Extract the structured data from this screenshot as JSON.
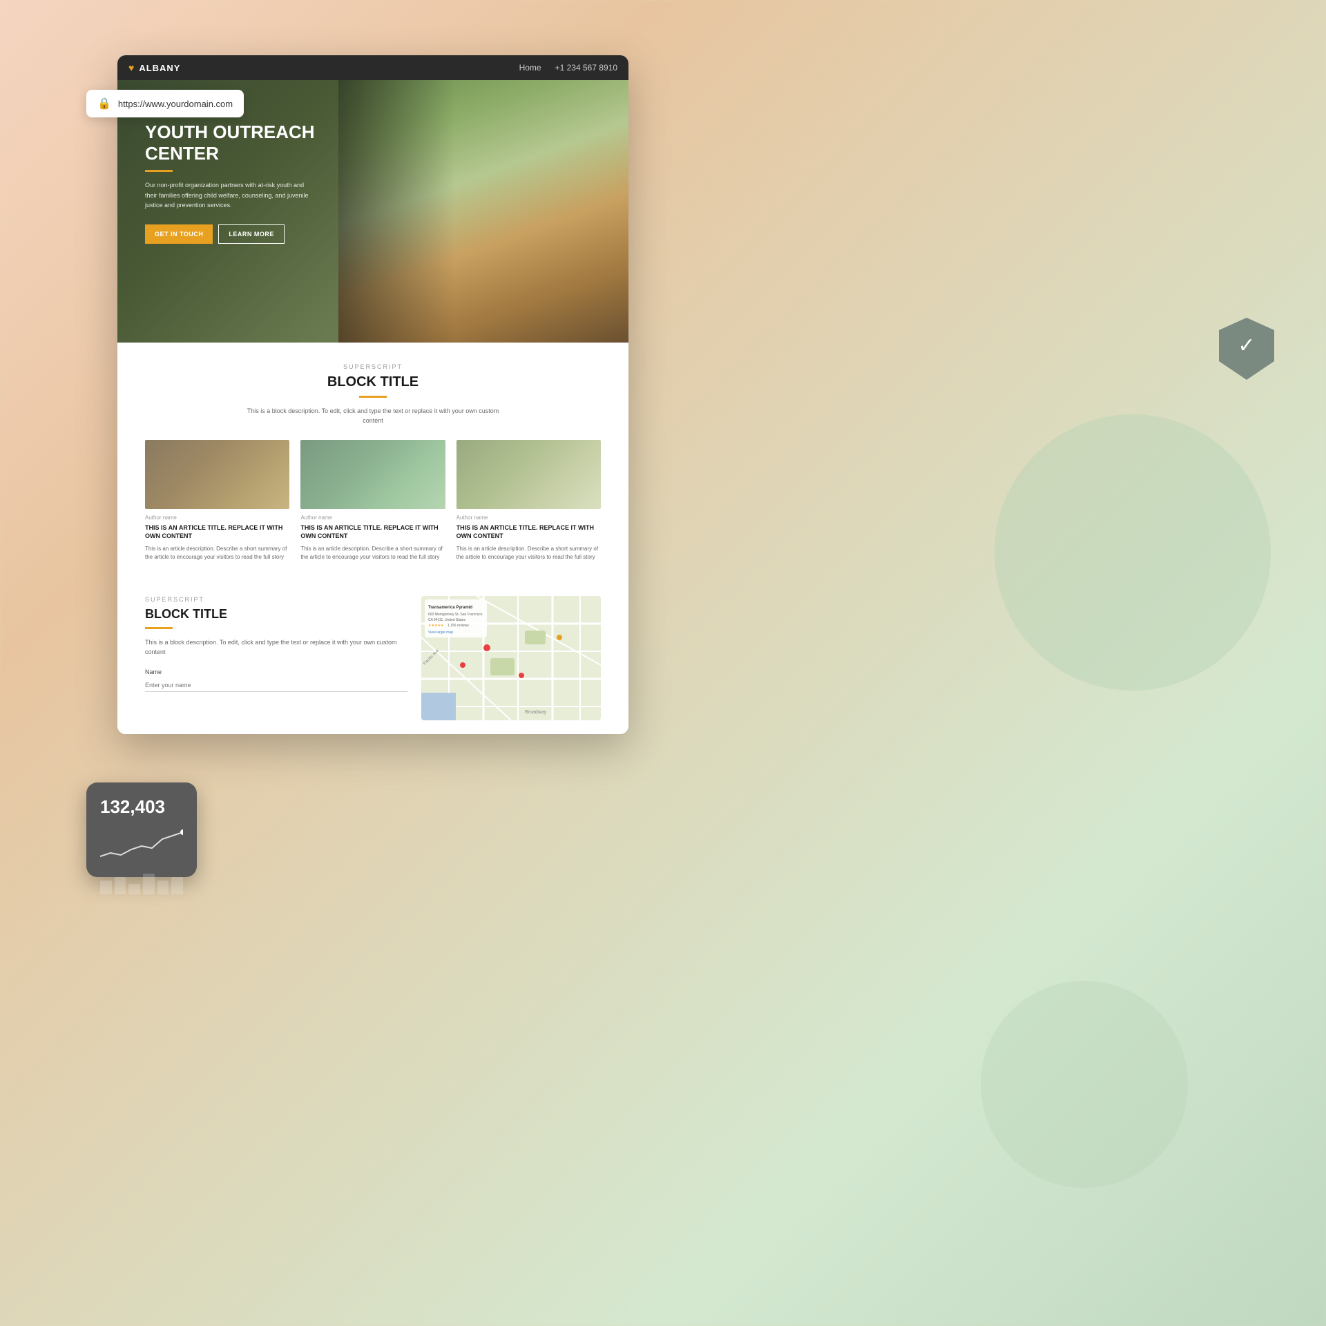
{
  "browser": {
    "logo": "ALBANY",
    "heart": "♥",
    "nav": {
      "home": "Home",
      "phone": "+1 234 567 8910"
    },
    "address": "https://www.yourdomain.com"
  },
  "hero": {
    "title": "YOUTH OUTREACH CENTER",
    "description": "Our non-profit organization partners with at-risk youth and their families offering child welfare, counseling, and juvenile justice and prevention services.",
    "btn_primary": "GET IN TOUCH",
    "btn_secondary": "LEARN MORE"
  },
  "block1": {
    "superscript": "SUPERSCRIPT",
    "title": "BLOCK TITLE",
    "underline": true,
    "description": "This is a block description. To edit, click and type the text or replace it with your own custom content",
    "articles": [
      {
        "author": "Author name",
        "title": "THIS IS AN ARTICLE TITLE. REPLACE IT WITH OWN CONTENT",
        "description": "This is an article description. Describe a short summary of the article to encourage your visitors to read the full story"
      },
      {
        "author": "Author name",
        "title": "THIS IS AN ARTICLE TITLE. REPLACE IT WITH OWN CONTENT",
        "description": "This is an article description. Describe a short summary of the article to encourage your visitors to read the full story"
      },
      {
        "author": "Author name",
        "title": "THIS IS AN ARTICLE TITLE. REPLACE IT WITH OWN CONTENT",
        "description": "This is an article description. Describe a short summary of the article to encourage your visitors to read the full story"
      }
    ]
  },
  "block2": {
    "superscript": "SUPERSCRIPT",
    "title": "BLOCK TITLE",
    "description": "This is a block description. To edit, click and type the text or replace it with your own custom content",
    "form": {
      "name_label": "Name",
      "name_placeholder": "Enter your name"
    }
  },
  "stats_widget": {
    "number": "132,403"
  },
  "shield_widget": {
    "check": "✓"
  },
  "get_in_touch": "GET IN ToucH"
}
